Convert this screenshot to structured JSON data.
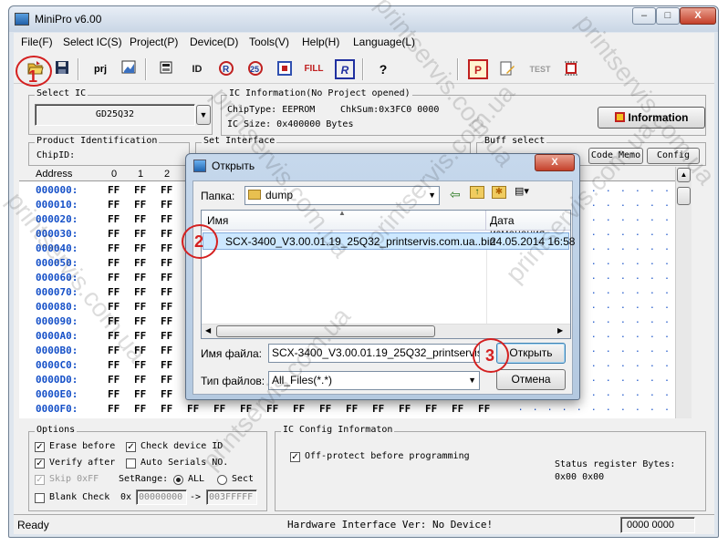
{
  "window": {
    "title": "MiniPro v6.00",
    "btn_min": "–",
    "btn_max": "□",
    "btn_close": "X"
  },
  "menu": [
    "File(F)",
    "Select IC(S)",
    "Project(P)",
    "Device(D)",
    "Tools(V)",
    "Help(H)",
    "Language(L)"
  ],
  "toolbar": {
    "prj": "prj",
    "id": "ID",
    "fill": "FILL",
    "r": "R",
    "help": "?",
    "p": "P",
    "test": "TEST"
  },
  "select_ic": {
    "label": "Select IC",
    "value": "GD25Q32"
  },
  "ic_info": {
    "label": "IC Information(No Project opened)",
    "chip_type": "ChipType:  EEPROM",
    "chksum": "ChkSum:0x3FC0 0000",
    "ic_size": "IC Size:   0x400000 Bytes",
    "info_button": "Information"
  },
  "product": {
    "label": "Product Identification",
    "chip_id": "ChipID:"
  },
  "set_interface": {
    "label": "Set Interface"
  },
  "buff": {
    "label": "Buff select",
    "code_memo": "Code Memo",
    "config": "Config"
  },
  "hex": {
    "col_address": "Address",
    "cols": [
      "0",
      "1",
      "2"
    ],
    "addresses": [
      "000000:",
      "000010:",
      "000020:",
      "000030:",
      "000040:",
      "000050:",
      "000060:",
      "000070:",
      "000080:",
      "000090:",
      "0000A0:",
      "0000B0:",
      "0000C0:",
      "0000D0:",
      "0000E0:",
      "0000F0:"
    ],
    "cell": "FF",
    "dots": ". . . . . . . . . . ."
  },
  "options": {
    "label": "Options",
    "erase_before": "Erase before",
    "check_device_id": "Check device ID",
    "verify_after": "Verify after",
    "auto_serials": "Auto Serials NO.",
    "skip_ff": "Skip 0xFF",
    "setrange": "SetRange:",
    "all": "ALL",
    "sect": "Sect",
    "blank_check": "Blank Check",
    "ox": "0x",
    "range_from": "00000000",
    "arrow": "->",
    "range_to": "003FFFFF"
  },
  "ic_config": {
    "label": "IC Config Informaton",
    "off_protect": "Off-protect before programming",
    "status_reg_label": "Status register Bytes:",
    "status_reg_value": "0x00 0x00"
  },
  "status_bar": {
    "ready": "Ready",
    "hw": "Hardware Interface Ver: No Device!",
    "counter": "0000 0000"
  },
  "dialog": {
    "title": "Открыть",
    "close": "X",
    "folder_label": "Папка:",
    "folder_value": "dump",
    "col_name": "Имя",
    "col_date": "Дата изменения",
    "file_name": "SCX-3400_V3.00.01.19_25Q32_printservis.com.ua..bin",
    "file_date": "24.05.2014 16:58",
    "filename_label": "Имя файла:",
    "filename_value": "SCX-3400_V3.00.01.19_25Q32_printservis.com",
    "filetype_label": "Тип файлов:",
    "filetype_value": "All_Files(*.*)",
    "open_button": "Открыть",
    "cancel_button": "Отмена"
  },
  "callouts": [
    "1",
    "2",
    "3"
  ],
  "watermark": "printservis.com.ua",
  "colors": {
    "address": "#1550c8",
    "callout": "#d42020",
    "selection": "#cde8ff"
  }
}
